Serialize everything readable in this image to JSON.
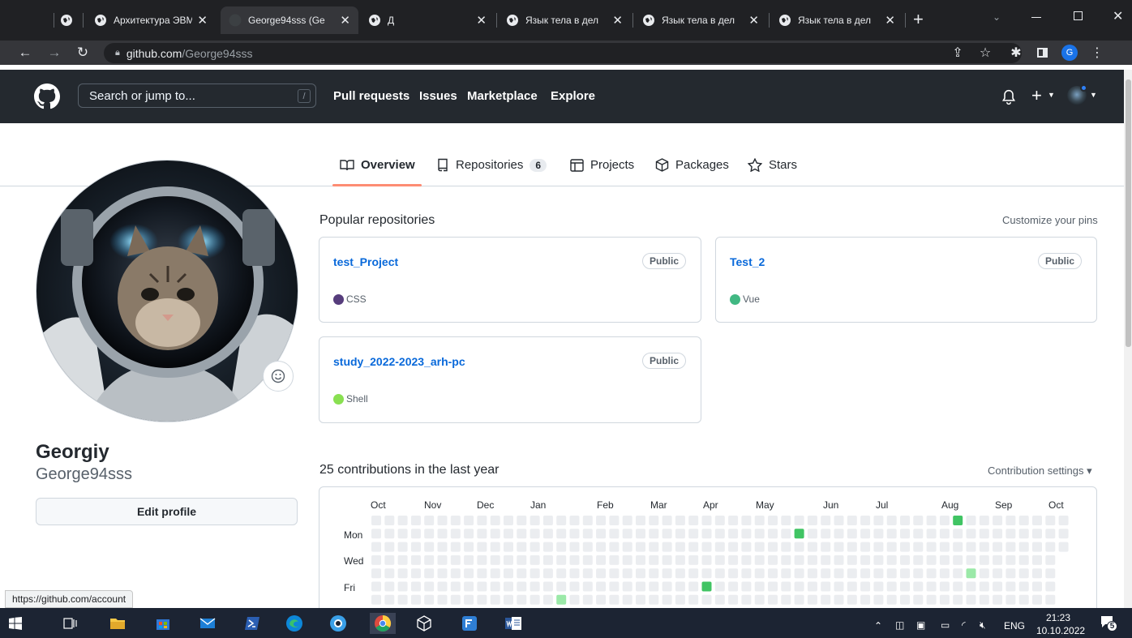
{
  "browser": {
    "tabs": [
      {
        "label": ""
      },
      {
        "label": "Архитектура ЭВМ"
      },
      {
        "label": "George94sss (Ge"
      },
      {
        "label": "Д"
      },
      {
        "label": "Язык тела в дел"
      },
      {
        "label": "Язык тела в дел"
      },
      {
        "label": "Язык тела в дел"
      }
    ],
    "url_host": "github.com",
    "url_path": "/George94sss",
    "profile_initial": "G",
    "status_link": "https://github.com/account"
  },
  "header": {
    "search_placeholder": "Search or jump to...",
    "search_hint": "/",
    "nav": [
      "Pull requests",
      "Issues",
      "Marketplace",
      "Explore"
    ],
    "plus": "+"
  },
  "profile_tabs": {
    "overview": "Overview",
    "repositories": "Repositories",
    "repositories_count": "6",
    "projects": "Projects",
    "packages": "Packages",
    "stars": "Stars"
  },
  "sidebar": {
    "full_name": "Georgiy",
    "username": "George94sss",
    "edit_profile": "Edit profile"
  },
  "popular": {
    "title": "Popular repositories",
    "customize": "Customize your pins",
    "repos": [
      {
        "name": "test_Project",
        "visibility": "Public",
        "language": "CSS",
        "color": "#563d7c"
      },
      {
        "name": "Test_2",
        "visibility": "Public",
        "language": "Vue",
        "color": "#41b883"
      },
      {
        "name": "study_2022-2023_arh-pc",
        "visibility": "Public",
        "language": "Shell",
        "color": "#89e051"
      }
    ]
  },
  "contributions": {
    "title": "25 contributions in the last year",
    "settings": "Contribution settings ▾",
    "months": [
      "Oct",
      "Nov",
      "Dec",
      "Jan",
      "Feb",
      "Mar",
      "Apr",
      "May",
      "Jun",
      "Jul",
      "Aug",
      "Sep",
      "Oct"
    ],
    "days": [
      "Mon",
      "Wed",
      "Fri"
    ],
    "colors": {
      "empty": "#ebedf0",
      "l1": "#9be9a8",
      "l2": "#40c463",
      "l3": "#30a14e",
      "l4": "#216e39"
    }
  },
  "taskbar": {
    "lang": "ENG",
    "time": "21:23",
    "date": "10.10.2022",
    "notifications": "5"
  }
}
